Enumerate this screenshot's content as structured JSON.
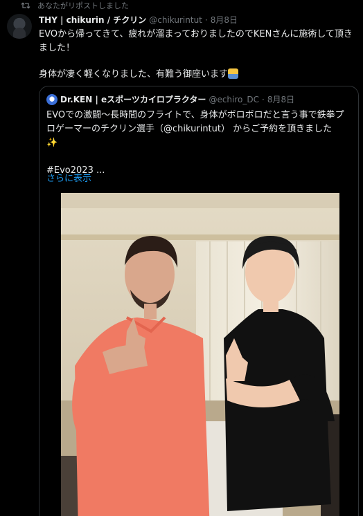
{
  "repost": {
    "text": "あなたがリポストしました"
  },
  "tweet": {
    "author_name": "THY | chikurin / チクリン",
    "handle": "@chikurintut",
    "separator": "·",
    "date": "8月8日",
    "line1": "EVOから帰ってきて、疲れが溜まっておりましたのでKENさんに施術して頂きました！",
    "line2": "身体が凄く軽くなりました、有難う御座います"
  },
  "quoted": {
    "author_name": "Dr.KEN | eスポーツカイロプラクター",
    "handle": "@echiro_DC",
    "separator": "·",
    "date": "8月8日",
    "text": "EVOでの激闘〜長時間のフライトで、身体がボロボロだと言う事で鉄拳プロゲーマーのチクリン選手（@chikurintut） からご予約を頂きました",
    "sparkle": "✨",
    "hashtag": "#Evo2023 ...",
    "show_more": "さらに表示"
  },
  "colors": {
    "accent": "#1d9bf0",
    "muted": "#71767b",
    "text": "#e7e9ea",
    "background": "#000000"
  },
  "icons": [
    "repost-icon",
    "user-avatar",
    "quoted-avatar",
    "sparkles-emoji",
    "bowing-emoji"
  ]
}
